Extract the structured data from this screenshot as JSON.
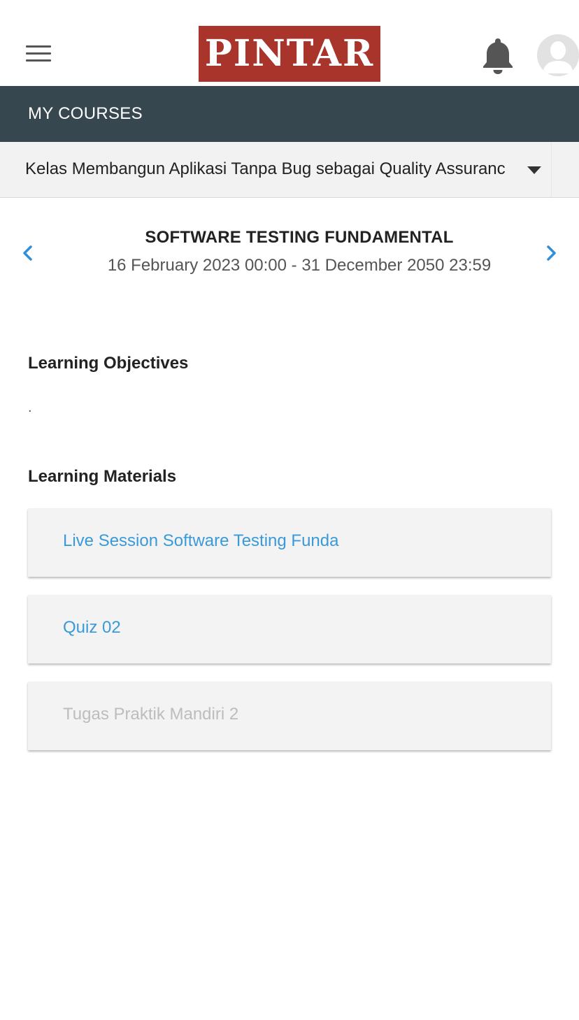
{
  "header": {
    "logo_text": "PINTAR",
    "brand_color": "#a8342b",
    "menu_icon": "hamburger-menu-icon",
    "notification_icon": "bell-icon",
    "avatar_icon": "user-avatar-icon"
  },
  "courses_bar": {
    "title": "MY COURSES",
    "color": "#37474f"
  },
  "class_select": {
    "selected_value": "Kelas Membangun Aplikasi Tanpa Bug sebagai Quality Assuranc",
    "icon": "caret-down-icon"
  },
  "session": {
    "title": "SOFTWARE TESTING FUNDAMENTAL",
    "dates": "16 February 2023 00:00 - 31 December 2050 23:59",
    "prev_icon": "chevron-left-icon",
    "next_icon": "chevron-right-icon"
  },
  "objectives": {
    "heading": "Learning Objectives",
    "text": "."
  },
  "materials": {
    "heading": "Learning Materials",
    "items": [
      {
        "label": "Live Session Software Testing Funda",
        "state": "active"
      },
      {
        "label": "Quiz 02",
        "state": "active"
      },
      {
        "label": "Tugas Praktik Mandiri 2",
        "state": "disabled"
      }
    ],
    "link_color": "#3a9ad9",
    "disabled_color": "#bdbdbd"
  }
}
